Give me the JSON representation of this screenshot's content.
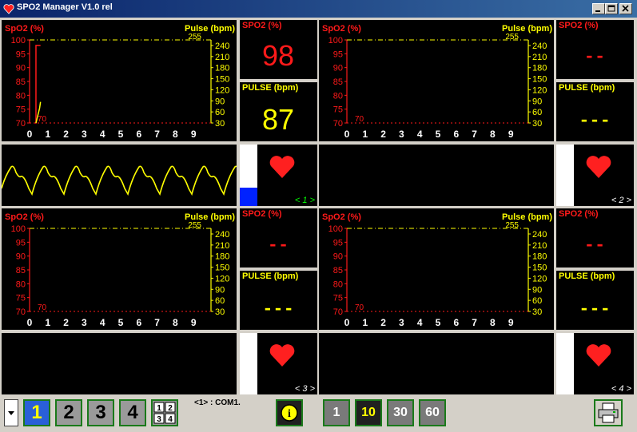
{
  "window": {
    "title": "SPO2 Manager V1.0 rel"
  },
  "chart_labels": {
    "spo2_axis": "SpO2 (%)",
    "pulse_axis": "Pulse (bpm)",
    "marker_255": "255",
    "marker_70": "70",
    "spo2_ticks": [
      "100",
      "95",
      "90",
      "85",
      "80",
      "75",
      "70"
    ],
    "pulse_ticks": [
      "240",
      "210",
      "180",
      "150",
      "120",
      "90",
      "60",
      "30"
    ],
    "time_ticks": [
      "0",
      "1",
      "2",
      "3",
      "4",
      "5",
      "6",
      "7",
      "8",
      "9"
    ]
  },
  "chart_data": {
    "type": "line",
    "series": [
      {
        "name": "SpO2 (%)",
        "x": [
          0.3,
          0.35,
          0.35,
          0.6
        ],
        "y": [
          70,
          70,
          98,
          98
        ]
      },
      {
        "name": "Pulse (bpm)",
        "x": [
          0.35,
          0.45,
          0.55,
          0.6
        ],
        "y": [
          30,
          50,
          70,
          87
        ]
      }
    ],
    "xlim": [
      0,
      10
    ],
    "ylim_left": [
      70,
      100
    ],
    "ylim_right": [
      30,
      255
    ]
  },
  "monitors": [
    {
      "slot": "< 1 >",
      "spo2_label": "SPO2 (%)",
      "pulse_label": "PULSE (bpm)",
      "spo2_value": "98",
      "pulse_value": "87",
      "active": true,
      "signal_fraction": 0.3
    },
    {
      "slot": "< 2 >",
      "spo2_label": "SPO2 (%)",
      "pulse_label": "PULSE (bpm)",
      "spo2_value": "--",
      "pulse_value": "---",
      "active": false,
      "signal_fraction": 0
    },
    {
      "slot": "< 3 >",
      "spo2_label": "SPO2 (%)",
      "pulse_label": "PULSE (bpm)",
      "spo2_value": "--",
      "pulse_value": "---",
      "active": false,
      "signal_fraction": 0
    },
    {
      "slot": "< 4 >",
      "spo2_label": "SPO2 (%)",
      "pulse_label": "PULSE (bpm)",
      "spo2_value": "--",
      "pulse_value": "---",
      "active": false,
      "signal_fraction": 0
    }
  ],
  "toolbar": {
    "view_buttons": [
      "1",
      "2",
      "3",
      "4"
    ],
    "grid_button_cells": [
      "1",
      "2",
      "3",
      "4"
    ],
    "com_status": "<1> : COM1.",
    "info_label": "i",
    "time_buttons": [
      "1",
      "10",
      "30",
      "60"
    ],
    "selected_view": "1",
    "selected_time": "10"
  },
  "colors": {
    "spo2": "#ff1a1a",
    "pulse": "#ffff00",
    "background": "#000000",
    "signal": "#0022ff",
    "slot_active": "#00ff00",
    "slot_idle": "#ffffff"
  }
}
